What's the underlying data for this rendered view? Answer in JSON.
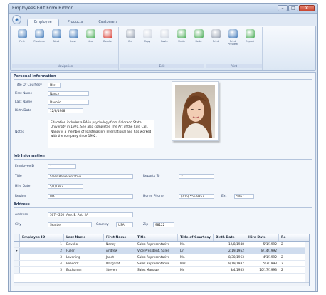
{
  "window": {
    "title": "Employees Edit Form Ribbon",
    "controls": {
      "minimize": "–",
      "maximize": "□",
      "close": "✕"
    }
  },
  "quick_access": {
    "icon": "app-menu-icon"
  },
  "tabs": [
    {
      "label": "Employee",
      "active": true
    },
    {
      "label": "Products",
      "active": false
    },
    {
      "label": "Customers",
      "active": false
    }
  ],
  "ribbon": {
    "groups": [
      {
        "label": "Navigation",
        "buttons": [
          {
            "label": "First",
            "icon": "nav-first-icon",
            "color": "#2f6db3"
          },
          {
            "label": "Previous",
            "icon": "nav-prev-icon",
            "color": "#2f6db3"
          },
          {
            "label": "Next",
            "icon": "nav-next-icon",
            "color": "#2f6db3"
          },
          {
            "label": "Last",
            "icon": "nav-last-icon",
            "color": "#2f6db3"
          },
          {
            "label": "New",
            "icon": "add-icon",
            "color": "#3aa548"
          },
          {
            "label": "Delete",
            "icon": "delete-icon",
            "color": "#d42a1f"
          }
        ]
      },
      {
        "label": "Edit",
        "buttons": [
          {
            "label": "Cut",
            "icon": "cut-icon",
            "color": "#8a96a8"
          },
          {
            "label": "Copy",
            "icon": "copy-icon",
            "color": "#c7cfdc"
          },
          {
            "label": "Paste",
            "icon": "paste-icon",
            "color": "#c7cfdc"
          },
          {
            "label": "Undo",
            "icon": "undo-icon",
            "color": "#3aa548"
          },
          {
            "label": "Redo",
            "icon": "redo-icon",
            "color": "#3aa548"
          }
        ]
      },
      {
        "label": "Print",
        "buttons": [
          {
            "label": "Print",
            "icon": "print-icon",
            "color": "#8a96a8"
          },
          {
            "label": "Print Preview",
            "icon": "print-preview-icon",
            "color": "#2f6db3"
          },
          {
            "label": "Export",
            "icon": "export-icon",
            "color": "#3aa548"
          }
        ]
      }
    ]
  },
  "personal": {
    "section_title": "Personal Information",
    "fields": [
      {
        "label": "Title Of Courtesy",
        "value": "Mrs."
      },
      {
        "label": "First Name",
        "value": "Nancy"
      },
      {
        "label": "Last Name",
        "value": "Davolio"
      },
      {
        "label": "Birth Date",
        "value": "12/8/1948"
      }
    ],
    "notes_label": "Notes",
    "notes": "Education includes a BA in psychology from Colorado State University in 1970. She also completed The Art of the Cold Call. Nancy is a member of Toastmasters International and has worked with the company since 1992."
  },
  "job": {
    "section_title": "Job Information",
    "employee_id_label": "EmployeeID",
    "employee_id": "1",
    "title_label": "Title",
    "title": "Sales Representative",
    "reports_to_label": "Reports To",
    "reports_to": "2",
    "hire_date_label": "Hire Date",
    "hire_date": "5/1/1992",
    "region_label": "Region",
    "region": "WA",
    "home_phone_label": "Home Phone",
    "home_phone": "(206) 555-9857",
    "ext_label": "Ext",
    "ext": "5467"
  },
  "address": {
    "section_title": "Address",
    "address_label": "Address",
    "address": "507 - 20th Ave. E. Apt. 2A",
    "city_label": "City",
    "city": "Seattle",
    "country_label": "Country",
    "country": "USA",
    "zip_label": "Zip",
    "zip": "98122"
  },
  "grid": {
    "columns": [
      "Employee ID",
      "Last Name",
      "First Name",
      "Title",
      "Title of Courtesy",
      "Birth Date",
      "Hire Date",
      "Re"
    ],
    "rows": [
      [
        "1",
        "Davolio",
        "Nancy",
        "Sales Representative",
        "Ms.",
        "12/8/1948",
        "5/1/1992",
        "2"
      ],
      [
        "2",
        "Fuller",
        "Andrew",
        "Vice President, Sales",
        "Dr.",
        "2/19/1952",
        "8/14/1992",
        ""
      ],
      [
        "3",
        "Leverling",
        "Janet",
        "Sales Representative",
        "Ms.",
        "8/30/1963",
        "4/1/1992",
        "2"
      ],
      [
        "4",
        "Peacock",
        "Margaret",
        "Sales Representative",
        "Mrs.",
        "9/19/1937",
        "5/3/1993",
        "2"
      ],
      [
        "5",
        "Buchanan",
        "Steven",
        "Sales Manager",
        "Mr.",
        "3/4/1955",
        "10/17/1993",
        "2"
      ]
    ],
    "selected_row": 1,
    "indicator": "▸"
  }
}
